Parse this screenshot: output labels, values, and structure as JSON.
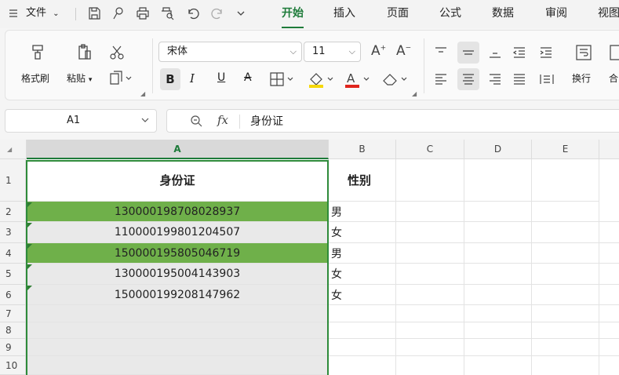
{
  "menubar": {
    "menu_icon": "hamburger-icon",
    "file_label": "文件",
    "tabs": [
      "开始",
      "插入",
      "页面",
      "公式",
      "数据",
      "审阅",
      "视图"
    ],
    "active_tab": "开始",
    "accent_color": "#1e7b3a"
  },
  "ribbon": {
    "format_painter": "格式刷",
    "paste": "粘贴",
    "font_name": "宋体",
    "font_size": "11",
    "wrap": "换行",
    "merge": "合"
  },
  "formula_bar": {
    "cell_ref": "A1",
    "fx": "fx",
    "content": "身份证"
  },
  "sheet": {
    "columns": [
      "A",
      "B",
      "C",
      "D",
      "E"
    ],
    "rows": [
      "1",
      "2",
      "3",
      "4",
      "5",
      "6",
      "7",
      "8",
      "9",
      "10"
    ],
    "header": {
      "a": "身份证",
      "b": "性别"
    },
    "data": [
      {
        "id": "130000198708028937",
        "gender": "男",
        "highlight": true
      },
      {
        "id": "110000199801204507",
        "gender": "女",
        "highlight": false
      },
      {
        "id": "150000195805046719",
        "gender": "男",
        "highlight": true
      },
      {
        "id": "130000195004143903",
        "gender": "女",
        "highlight": false
      },
      {
        "id": "150000199208147962",
        "gender": "女",
        "highlight": false
      }
    ],
    "highlight_color": "#6fb04a"
  }
}
